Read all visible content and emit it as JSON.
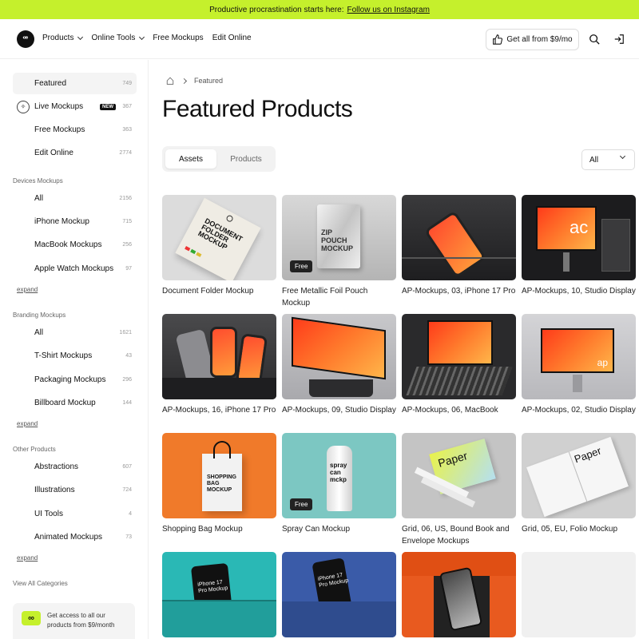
{
  "promo": {
    "text": "Productive procrastination starts here:",
    "link": "Follow us on Instagram"
  },
  "header": {
    "logo": "ꟹ",
    "nav": [
      {
        "label": "Products",
        "dropdown": true
      },
      {
        "label": "Online Tools",
        "dropdown": true
      },
      {
        "label": "Free Mockups",
        "dropdown": false
      },
      {
        "label": "Edit Online",
        "dropdown": false
      }
    ],
    "cta": "Get all from $9/mo",
    "icons": [
      "thumbs-up-icon",
      "search-icon",
      "login-icon"
    ]
  },
  "sidebar": {
    "top": [
      {
        "label": "Featured",
        "count": "749",
        "active": true
      },
      {
        "label": "Live Mockups",
        "count": "367",
        "badge": "NEW",
        "icon": "live-icon"
      },
      {
        "label": "Free Mockups",
        "count": "363"
      },
      {
        "label": "Edit Online",
        "count": "2774"
      }
    ],
    "groups": [
      {
        "heading": "Devices Mockups",
        "items": [
          {
            "label": "All",
            "count": "2156"
          },
          {
            "label": "iPhone Mockup",
            "count": "715"
          },
          {
            "label": "MacBook Mockups",
            "count": "256"
          },
          {
            "label": "Apple Watch Mockups",
            "count": "97"
          }
        ],
        "expand": "expand"
      },
      {
        "heading": "Branding Mockups",
        "items": [
          {
            "label": "All",
            "count": "1621"
          },
          {
            "label": "T-Shirt Mockups",
            "count": "43"
          },
          {
            "label": "Packaging Mockups",
            "count": "296"
          },
          {
            "label": "Billboard Mockup",
            "count": "144"
          }
        ],
        "expand": "expand"
      },
      {
        "heading": "Other Products",
        "items": [
          {
            "label": "Abstractions",
            "count": "607"
          },
          {
            "label": "Illustrations",
            "count": "724"
          },
          {
            "label": "UI Tools",
            "count": "4"
          },
          {
            "label": "Animated Mockups",
            "count": "73"
          }
        ],
        "expand": "expand"
      }
    ],
    "view_all": "View All Categories",
    "promo_card": {
      "icon": "∞",
      "text": "Get access to all our products from $9/month"
    }
  },
  "main": {
    "breadcrumb": [
      "home-icon",
      "Featured"
    ],
    "title": "Featured Products",
    "tabs": [
      {
        "label": "Assets",
        "active": true
      },
      {
        "label": "Products",
        "active": false
      }
    ],
    "filter": "All",
    "free_label": "Free",
    "cards": [
      {
        "caption": "Document Folder Mockup",
        "thumb": "folder",
        "bg": "#dcdcdc"
      },
      {
        "caption": "Free Metallic Foil Pouch Mockup",
        "thumb": "pouch",
        "bg": "#c9c9c9",
        "free": true
      },
      {
        "caption": "AP-Mockups, 03, iPhone 17 Pro",
        "thumb": "iphone-dark",
        "bg": "#2c2c2e"
      },
      {
        "caption": "AP-Mockups, 10, Studio Display",
        "thumb": "studio-dark",
        "bg": "#1c1c1e"
      },
      {
        "caption": "AP-Mockups, 16, iPhone 17 Pro",
        "thumb": "iphones-blocks",
        "bg": "#3a3a3c"
      },
      {
        "caption": "AP-Mockups, 09, Studio Display",
        "thumb": "studio-tilt",
        "bg": "#bfbfc2"
      },
      {
        "caption": "AP-Mockups, 06, MacBook",
        "thumb": "macbook",
        "bg": "#2a2a2c"
      },
      {
        "caption": "AP-Mockups, 02, Studio Display",
        "thumb": "studio-front",
        "bg": "#c8c8cb"
      },
      {
        "caption": "Shopping Bag Mockup",
        "thumb": "bag",
        "bg": "#f07a2a"
      },
      {
        "caption": "Spray Can Mockup",
        "thumb": "spray",
        "bg": "#7cc7c2",
        "free": true
      },
      {
        "caption": "Grid, 06, US, Bound Book and Envelope Mockups",
        "thumb": "book",
        "bg": "#c4c4c4"
      },
      {
        "caption": "Grid, 05, EU, Folio Mockup",
        "thumb": "folio",
        "bg": "#d0d0d0"
      },
      {
        "caption": "",
        "thumb": "backpack",
        "bg": "#2ab8b5"
      },
      {
        "caption": "",
        "thumb": "pocket-blue",
        "bg": "#3a5ba8"
      },
      {
        "caption": "",
        "thumb": "pocket-orange",
        "bg": "#e85a1f"
      },
      {
        "caption": "",
        "thumb": "blank",
        "bg": "#f0f0f0"
      }
    ],
    "thumb_text": {
      "folder": "DOCUMENT\nFOLDER\nMOCKUP",
      "pouch": "ZIP\nPOUCH\nMOCKUP",
      "studio_dark": "ac",
      "studio_front": "ap",
      "spray": "spray\ncan\nmckp",
      "book": "Paper",
      "folio": "Paper",
      "iphone": "iPhone 17\nPro Mockup",
      "bag": "SHOPPING\nBAG\nMOCKUP"
    }
  }
}
